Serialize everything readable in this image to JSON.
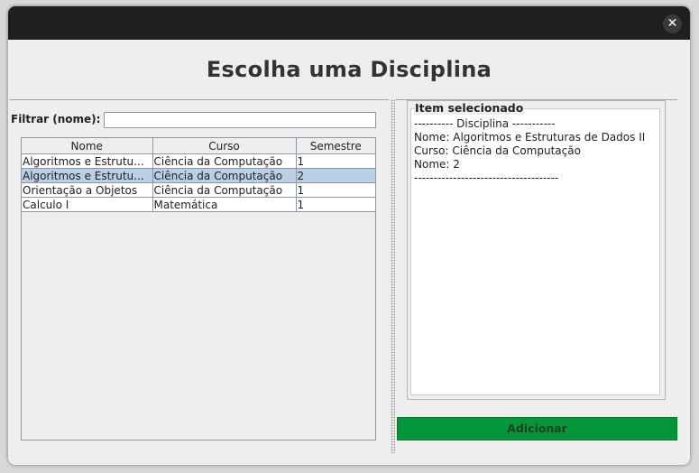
{
  "window": {
    "close_glyph": "✕"
  },
  "heading": "Escolha uma Disciplina",
  "filter": {
    "label": "Filtrar (nome):",
    "value": ""
  },
  "table": {
    "columns": [
      "Nome",
      "Curso",
      "Semestre"
    ],
    "rows": [
      [
        "Algoritmos e Estrutu...",
        "Ciência da Computação",
        "1"
      ],
      [
        "Algoritmos e Estrutu...",
        "Ciência da Computação",
        "2"
      ],
      [
        "Orientação a Objetos",
        "Ciência da Computação",
        "1"
      ],
      [
        "Calculo I",
        "Matemática",
        "1"
      ]
    ],
    "selected_row": 1
  },
  "selected_item": {
    "title": "Item selecionado",
    "lines": [
      "---------- Disciplina -----------",
      "Nome: Algoritmos e Estruturas de Dados II",
      "Curso: Ciência da Computação",
      "Nome: 2",
      "-------------------------------------"
    ]
  },
  "add_button": {
    "label": "Adicionar"
  },
  "colors": {
    "titlebar": "#1f1f1f",
    "selection": "#b8cfe5",
    "add_button": "#06963a"
  }
}
